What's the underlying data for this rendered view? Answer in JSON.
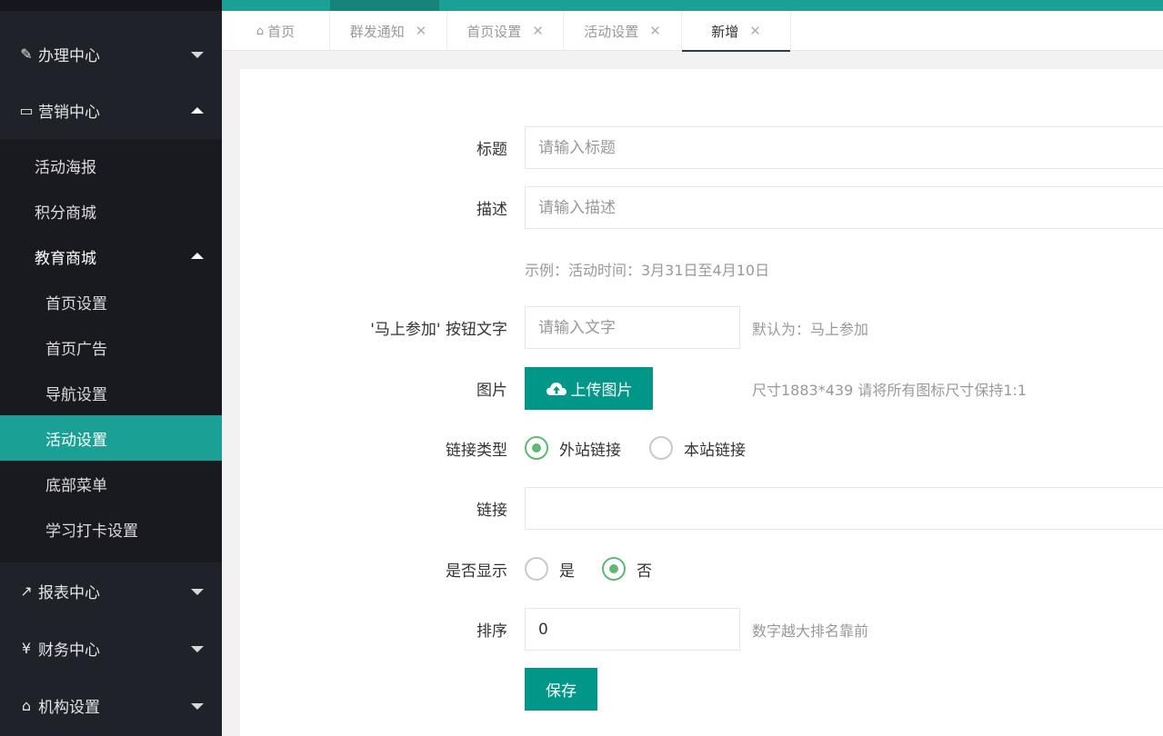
{
  "sidebar": {
    "groups": [
      {
        "label": "办理中心",
        "icon": "edit-icon",
        "glyph": "✎"
      },
      {
        "label": "营销中心",
        "icon": "laptop-icon",
        "glyph": "▭"
      },
      {
        "label": "报表中心",
        "icon": "chart-line-icon",
        "glyph": "↗"
      },
      {
        "label": "财务中心",
        "icon": "yen-icon",
        "glyph": "¥"
      },
      {
        "label": "机构设置",
        "icon": "institution-icon",
        "glyph": "⌂"
      }
    ],
    "marketing_items": [
      "活动海报",
      "积分商城",
      "教育商城"
    ],
    "education_items": [
      "首页设置",
      "首页广告",
      "导航设置",
      "活动设置",
      "底部菜单",
      "学习打卡设置"
    ],
    "active_item": "活动设置"
  },
  "tabs": [
    {
      "label": "首页",
      "closable": false,
      "icon": "home-icon"
    },
    {
      "label": "群发通知",
      "closable": true
    },
    {
      "label": "首页设置",
      "closable": true
    },
    {
      "label": "活动设置",
      "closable": true
    },
    {
      "label": "新增",
      "closable": true,
      "active": true
    }
  ],
  "tab_close_glyph": "✕",
  "form": {
    "title_label": "标题",
    "title_placeholder": "请输入标题",
    "desc_label": "描述",
    "desc_placeholder": "请输入描述",
    "desc_example": "示例：活动时间：3月31日至4月10日",
    "button_text_label": "'马上参加' 按钮文字",
    "button_text_placeholder": "请输入文字",
    "button_text_hint": "默认为：马上参加",
    "image_label": "图片",
    "upload_label": "上传图片",
    "image_hint": "尺寸1883*439 请将所有图标尺寸保持1:1",
    "link_type_label": "链接类型",
    "link_type_options": [
      "外站链接",
      "本站链接"
    ],
    "link_type_selected": "外站链接",
    "link_label": "链接",
    "link_value": "",
    "show_label": "是否显示",
    "show_options": [
      "是",
      "否"
    ],
    "show_selected": "否",
    "sort_label": "排序",
    "sort_value": "0",
    "sort_hint": "数字越大排名靠前",
    "save_label": "保存"
  },
  "colors": {
    "accent": "#009688",
    "sidebar_active": "#1aa094",
    "sidebar_bg": "#20222a",
    "radio_on": "#5fb878"
  }
}
